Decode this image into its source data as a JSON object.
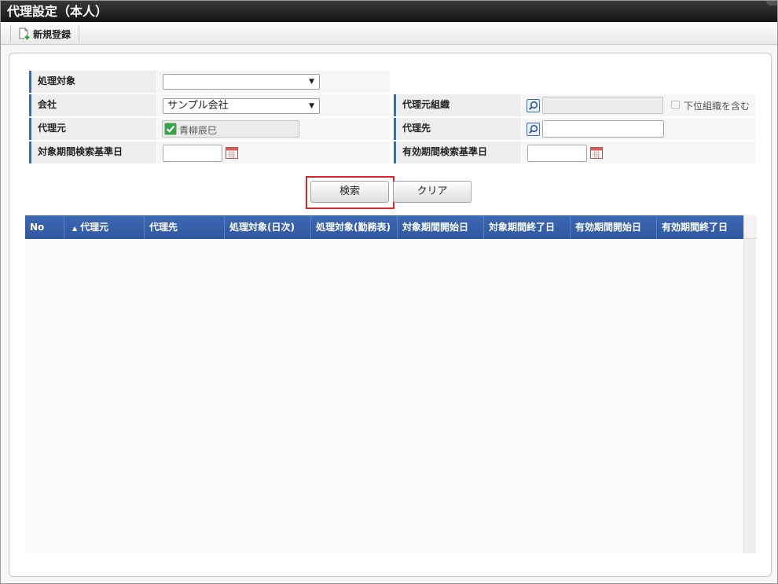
{
  "window": {
    "title": "代理設定（本人）"
  },
  "toolbar": {
    "new_label": "新規登録"
  },
  "form": {
    "target_label": "処理対象",
    "target_value": "",
    "company_label": "会社",
    "company_value": "サンプル会社",
    "org_label": "代理元組織",
    "include_sub_label": "下位組織を含む",
    "delegator_label": "代理元",
    "delegator_value": "青柳辰巳",
    "delegate_label": "代理先",
    "target_date_label": "対象期間検索基準日",
    "valid_date_label": "有効期間検索基準日"
  },
  "buttons": {
    "search": "検索",
    "clear": "クリア"
  },
  "grid": {
    "columns": [
      "No",
      "代理元",
      "代理先",
      "処理対象(日次)",
      "処理対象(勤務表)",
      "対象期間開始日",
      "対象期間終了日",
      "有効期間開始日",
      "有効期間終了日"
    ],
    "sort_indicator": "▲"
  },
  "colors": {
    "header_blue": "#2f579e",
    "label_accent": "#3b6bb3",
    "highlight_red": "#d7242d"
  }
}
